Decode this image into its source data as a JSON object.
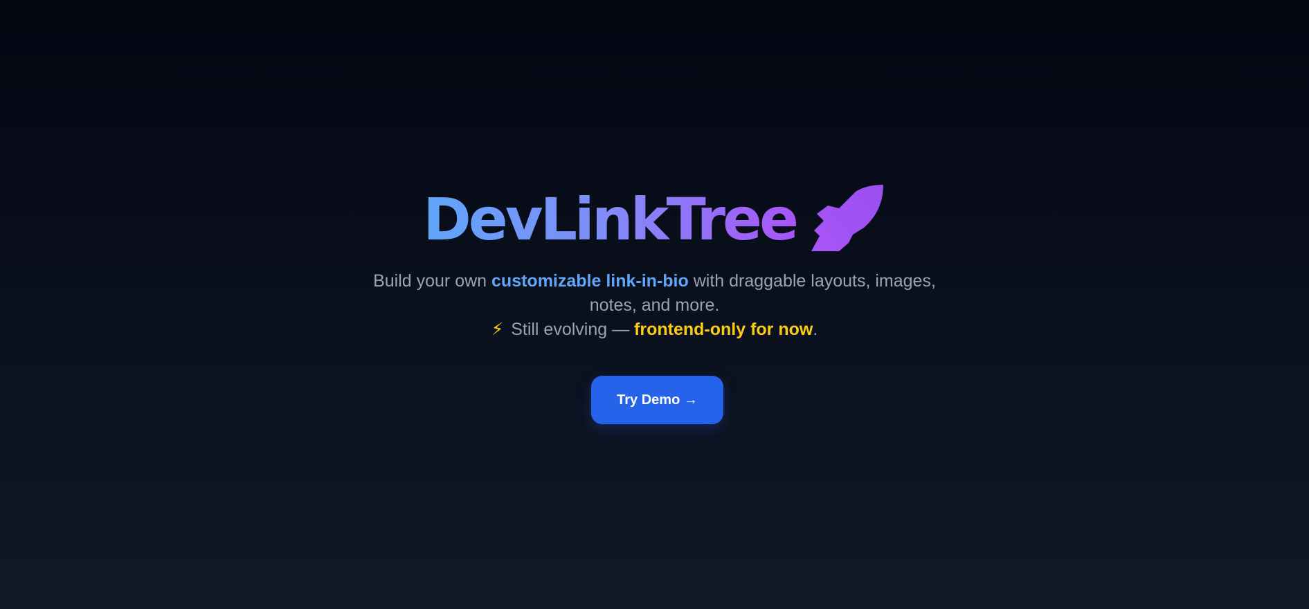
{
  "hero": {
    "title": "DevLinkTree",
    "title_icon": "rocket-icon",
    "subtitle": {
      "prefix": "Build your own ",
      "highlight": "customizable link-in-bio",
      "suffix_line1": " with draggable layouts, images,",
      "line2": "notes, and more.",
      "bolt_icon": "⚡",
      "note_prefix": " Still evolving — ",
      "note_highlight": "frontend-only for now",
      "note_suffix": "."
    },
    "cta_label": "Try Demo →"
  },
  "colors": {
    "background_top": "#030712",
    "background_bottom": "#111827",
    "title_gradient_start": "#60a5fa",
    "title_gradient_end": "#a855f7",
    "highlight_blue": "#60a5fa",
    "highlight_yellow": "#facc15",
    "button": "#2563eb",
    "muted_text": "#9ca3af"
  }
}
